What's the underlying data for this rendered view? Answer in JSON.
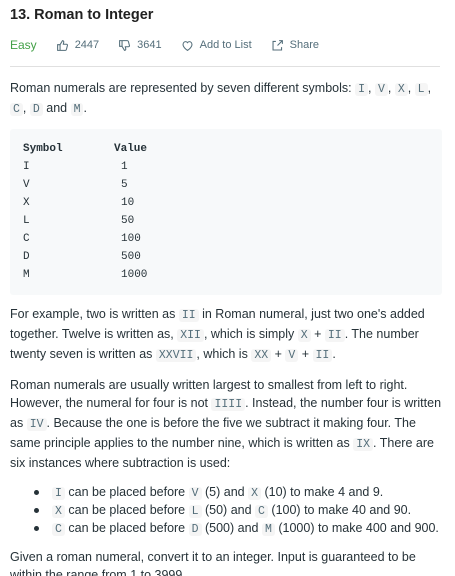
{
  "problem": {
    "title": "13. Roman to Integer",
    "difficulty": "Easy",
    "likes": "2447",
    "dislikes": "3641",
    "add_to_list": "Add to List",
    "share": "Share"
  },
  "description": {
    "intro_text": "Roman numerals are represented by seven different symbols: ",
    "symbols": [
      "I",
      "V",
      "X",
      "L",
      "C",
      "D",
      "M"
    ],
    "sep": ", ",
    "and": " and ",
    "period": ".",
    "table": {
      "header": [
        "Symbol",
        "Value"
      ],
      "rows": [
        [
          "I",
          "1"
        ],
        [
          "V",
          "5"
        ],
        [
          "X",
          "10"
        ],
        [
          "L",
          "50"
        ],
        [
          "C",
          "100"
        ],
        [
          "D",
          "500"
        ],
        [
          "M",
          "1000"
        ]
      ]
    },
    "example": {
      "t1": "For example, two is written as ",
      "c1": "II",
      "t2": " in Roman numeral, just two one's added together. Twelve is written as, ",
      "c2": "XII",
      "t3": ", which is simply ",
      "c3": "X",
      "t4": " + ",
      "c4": "II",
      "t5": ". The number twenty seven is written as ",
      "c5": "XXVII",
      "t6": ", which is ",
      "c6": "XX",
      "t7": " + ",
      "c7": "V",
      "t8": " + ",
      "c8": "II",
      "t9": "."
    },
    "order": {
      "t1": "Roman numerals are usually written largest to smallest from left to right. However, the numeral for four is not ",
      "c1": "IIII",
      "t2": ". Instead, the number four is written as ",
      "c2": "IV",
      "t3": ". Because the one is before the five we subtract it making four. The same principle applies to the number nine, which is written as ",
      "c3": "IX",
      "t4": ". There are six instances where subtraction is used:"
    },
    "rules": [
      {
        "sym": "I",
        "mid": " can be placed before ",
        "a": "V",
        "a_val": " (5) and ",
        "b": "X",
        "b_val": " (10) to make 4 and 9."
      },
      {
        "sym": "X",
        "mid": " can be placed before ",
        "a": "L",
        "a_val": " (50) and ",
        "b": "C",
        "b_val": " (100) to make 40 and 90."
      },
      {
        "sym": "C",
        "mid": " can be placed before ",
        "a": "D",
        "a_val": " (500) and ",
        "b": "M",
        "b_val": " (1000) to make 400 and 900."
      }
    ],
    "final": "Given a roman numeral, convert it to an integer. Input is guaranteed to be within the range from 1 to 3999."
  }
}
